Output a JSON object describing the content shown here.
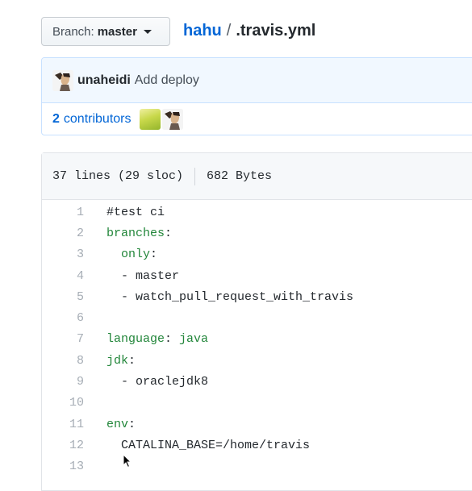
{
  "branch": {
    "label": "Branch:",
    "value": "master"
  },
  "breadcrumb": {
    "repo": "hahu",
    "separator": "/",
    "file": ".travis.yml"
  },
  "commit": {
    "author": "unaheidi",
    "message": "Add deploy"
  },
  "contributors": {
    "count": "2",
    "label": "contributors"
  },
  "file_info": {
    "lines": "37 lines (29 sloc)",
    "size": "682 Bytes"
  },
  "code": {
    "numbers": [
      "1",
      "2",
      "3",
      "4",
      "5",
      "6",
      "7",
      "8",
      "9",
      "10",
      "11",
      "12",
      "13"
    ],
    "l1": "#test ci",
    "l2_key": "branches",
    "l2_colon": ":",
    "l3_indent": "  ",
    "l3_key": "only",
    "l3_colon": ":",
    "l4": "  - master",
    "l5": "  - watch_pull_request_with_travis",
    "l7_key": "language",
    "l7_sep": ": ",
    "l7_val": "java",
    "l8_key": "jdk",
    "l8_colon": ":",
    "l9": "  - oraclejdk8",
    "l11_key": "env",
    "l11_colon": ":",
    "l12": "  CATALINA_BASE=/home/travis"
  }
}
